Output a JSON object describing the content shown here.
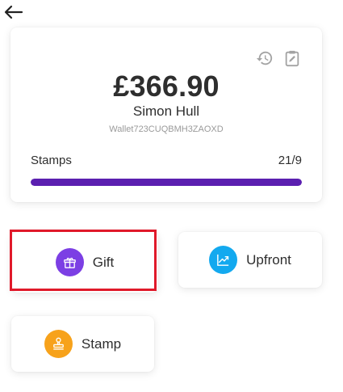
{
  "header": {
    "back_icon": "arrow-left-icon"
  },
  "wallet": {
    "balance": "£366.90",
    "holder_name": "Simon Hull",
    "wallet_id": "Wallet723CUQBMH3ZAOXD",
    "history_icon": "history-icon",
    "edit_icon": "clipboard-edit-icon",
    "stamps_label": "Stamps",
    "stamps_count": "21/9",
    "stamps_progress_fraction": 1.0,
    "progress_color": "#5b1fb0"
  },
  "actions": [
    {
      "label": "Gift",
      "icon": "gift-icon",
      "color": "#7c3fe4",
      "highlighted": true
    },
    {
      "label": "Upfront",
      "icon": "chart-up-icon",
      "color": "#13a9ef",
      "highlighted": false
    },
    {
      "label": "Stamp",
      "icon": "stamp-icon",
      "color": "#f7a21b",
      "highlighted": false
    }
  ],
  "colors": {
    "highlight_border": "#e0192a"
  }
}
